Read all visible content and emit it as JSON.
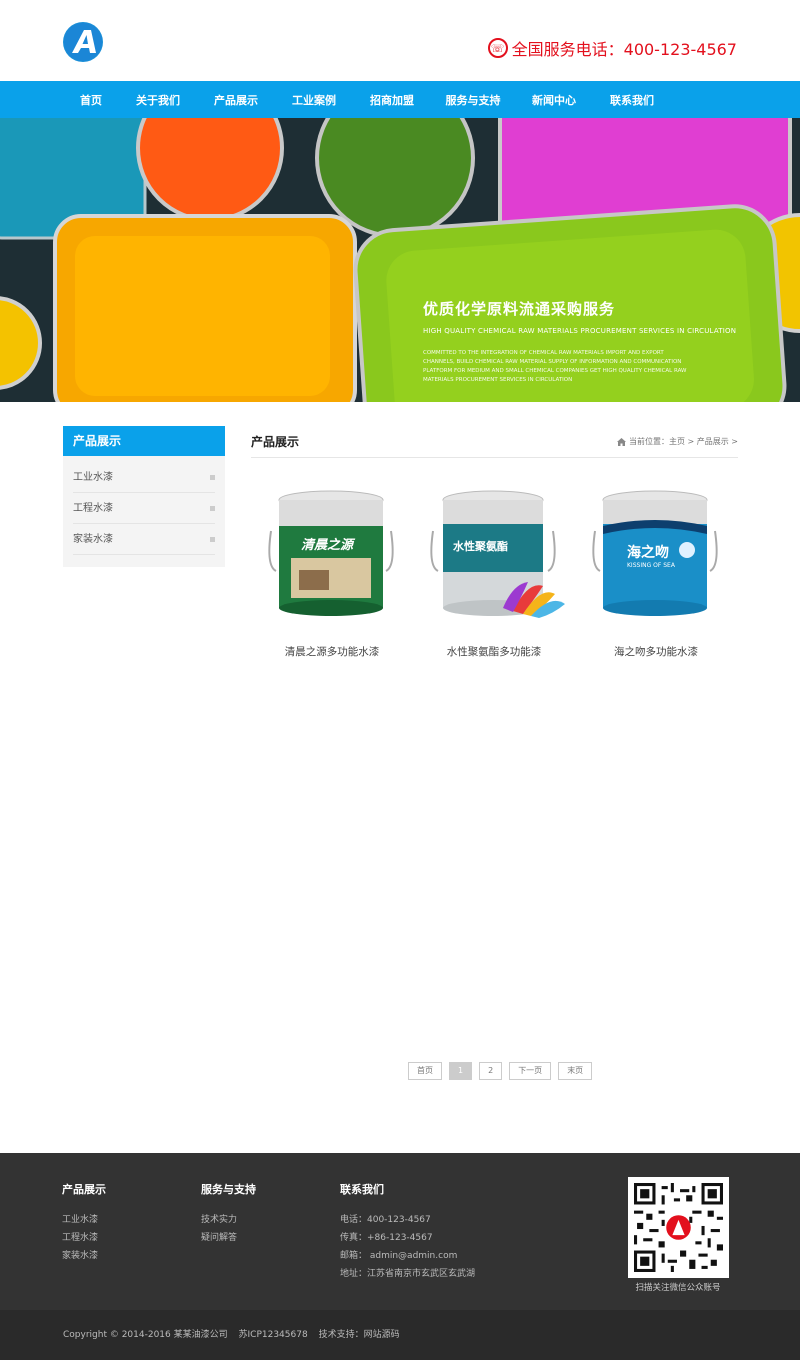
{
  "header": {
    "hotline": "全国服务电话：400-123-4567"
  },
  "nav": {
    "items": [
      "首页",
      "关于我们",
      "产品展示",
      "工业案例",
      "招商加盟",
      "服务与支持",
      "新闻中心",
      "联系我们"
    ]
  },
  "banner": {
    "title": "优质化学原料流通采购服务",
    "subtitle": "HIGH QUALITY CHEMICAL RAW MATERIALS PROCUREMENT SERVICES IN CIRCULATION",
    "desc": "COMMITTED TO THE INTEGRATION OF CHEMICAL RAW MATERIALS IMPORT AND EXPORT CHANNELS, BUILD CHEMICAL RAW MATERIAL SUPPLY OF INFORMATION AND COMMUNICATION PLATFORM FOR MEDIUM AND SMALL CHEMICAL COMPANIES GET HIGH QUALITY CHEMICAL RAW MATERIALS PROCUREMENT SERVICES IN CIRCULATION"
  },
  "sidebar": {
    "title": "产品展示",
    "items": [
      "工业水漆",
      "工程水漆",
      "家装水漆"
    ]
  },
  "content": {
    "title": "产品展示",
    "breadcrumb": "当前位置：主页 > 产品展示 >",
    "products": [
      {
        "name": "清晨之源多功能水漆",
        "can_label": "清晨之源",
        "color": "#1f7a3f"
      },
      {
        "name": "水性聚氨酯多功能漆",
        "can_label": "水性聚氨酯",
        "color": "#1c7a86"
      },
      {
        "name": "海之吻多功能水漆",
        "can_label": "海之吻",
        "can_sub": "KISSING OF SEA",
        "color": "#1a8fc8"
      }
    ]
  },
  "pager": {
    "first": "首页",
    "p1": "1",
    "p2": "2",
    "next": "下一页",
    "last": "末页"
  },
  "footer": {
    "col1": {
      "title": "产品展示",
      "items": [
        "工业水漆",
        "工程水漆",
        "家装水漆"
      ]
    },
    "col2": {
      "title": "服务与支持",
      "items": [
        "技术实力",
        "疑问解答"
      ]
    },
    "col3": {
      "title": "联系我们",
      "items": [
        "电话：400-123-4567",
        "传真：+86-123-4567",
        "邮箱： admin@admin.com",
        "地址：江苏省南京市玄武区玄武湖"
      ]
    },
    "qr_caption": "扫描关注微信公众账号"
  },
  "bottom": {
    "copyright": "Copyright © 2014-2016 某某油漆公司",
    "icp": "苏ICP12345678",
    "support": "技术支持：网站源码"
  },
  "colors": {
    "accent": "#0aa1ea",
    "hotline": "#e3101d",
    "footer": "#333333"
  }
}
